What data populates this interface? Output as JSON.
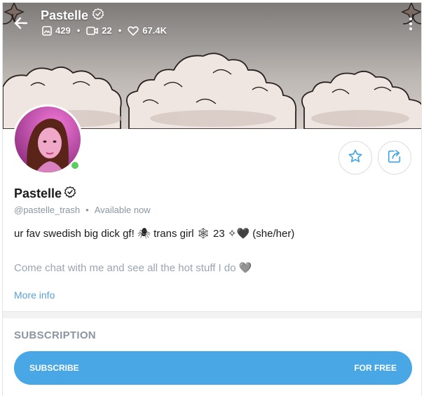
{
  "header": {
    "title": "Pastelle",
    "stats": {
      "photos": "429",
      "videos": "22",
      "likes": "67.4K"
    },
    "icons": [
      "back-arrow-icon",
      "verified-icon",
      "photo-icon",
      "video-icon",
      "heart-icon",
      "more-vertical-icon"
    ]
  },
  "profile": {
    "name": "Pastelle",
    "handle": "@pastelle_trash",
    "separator": "•",
    "status": "Available now",
    "bio_line1": "ur fav swedish big dick gf! 🕷 trans girl 🕸 23 ✧🖤 (she/her)",
    "bio_line2": "Come chat with me and see all the hot stuff I do 🩶",
    "more_info": "More info",
    "online": true
  },
  "actions": {
    "favorite_icon": "star-icon",
    "share_icon": "share-icon"
  },
  "subscription": {
    "heading": "SUBSCRIPTION",
    "button_label": "SUBSCRIBE",
    "button_price": "FOR FREE"
  },
  "colors": {
    "accent": "#4aa7e6",
    "link": "#5a9fd6",
    "muted": "#8a96a3",
    "online": "#5ccc5e"
  }
}
